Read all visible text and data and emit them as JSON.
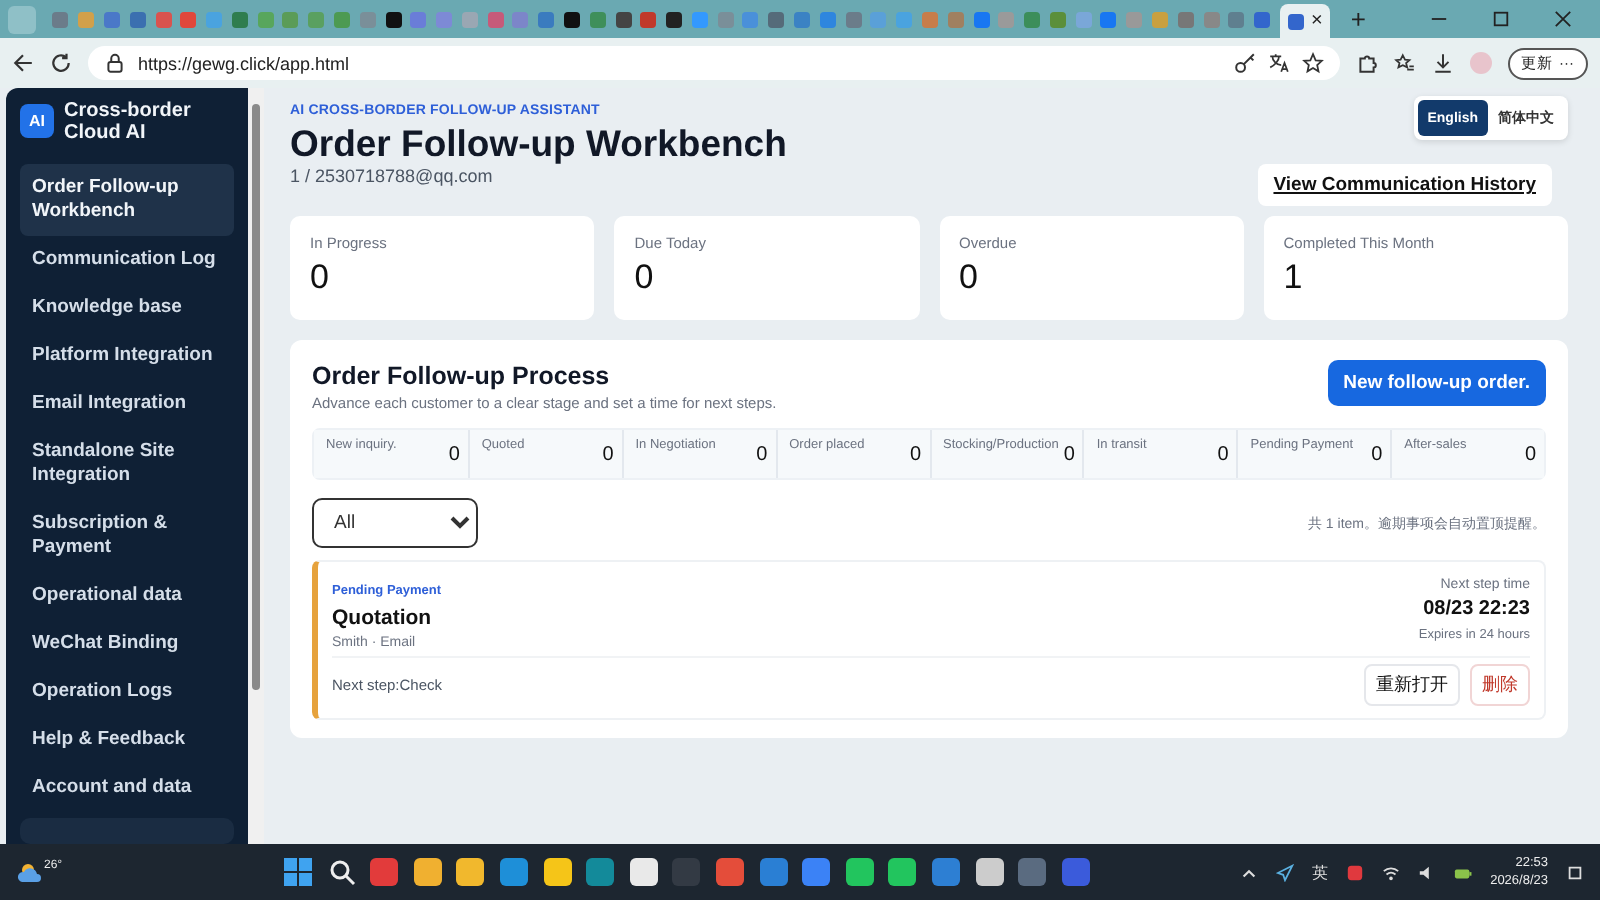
{
  "browser": {
    "tab_close": "×",
    "new_tab": "+",
    "url": "https://gewg.click/app.html",
    "update_button": "更新",
    "more": "···"
  },
  "sidebar": {
    "logo": "AI",
    "title": "Cross-border Cloud AI",
    "items": [
      {
        "label": "Order Follow-up Workbench",
        "selected": true
      },
      {
        "label": "Communication Log",
        "selected": false
      },
      {
        "label": "Knowledge base",
        "selected": false
      },
      {
        "label": "Platform Integration",
        "selected": false
      },
      {
        "label": "Email Integration",
        "selected": false
      },
      {
        "label": "Standalone Site Integration",
        "selected": false
      },
      {
        "label": "Subscription & Payment",
        "selected": false
      },
      {
        "label": "Operational data",
        "selected": false
      },
      {
        "label": "WeChat Binding",
        "selected": false
      },
      {
        "label": "Operation Logs",
        "selected": false
      },
      {
        "label": "Help & Feedback",
        "selected": false
      },
      {
        "label": "Account and data",
        "selected": false
      }
    ]
  },
  "header": {
    "eyebrow": "AI CROSS-BORDER FOLLOW-UP ASSISTANT",
    "title": "Order Follow-up Workbench",
    "subtitle": "1 / 2530718788@qq.com",
    "languages": [
      {
        "label": "English",
        "selected": true
      },
      {
        "label": "简体中文",
        "selected": false
      }
    ],
    "history_button": "View Communication History"
  },
  "stats": [
    {
      "label": "In Progress",
      "value": "0"
    },
    {
      "label": "Due Today",
      "value": "0"
    },
    {
      "label": "Overdue",
      "value": "0"
    },
    {
      "label": "Completed This Month",
      "value": "1"
    }
  ],
  "process": {
    "title": "Order Follow-up Process",
    "description": "Advance each customer to a clear stage and set a time for next steps.",
    "new_button": "New follow-up order.",
    "stages": [
      {
        "label": "New inquiry.",
        "count": "0"
      },
      {
        "label": "Quoted",
        "count": "0"
      },
      {
        "label": "In Negotiation",
        "count": "0"
      },
      {
        "label": "Order placed",
        "count": "0"
      },
      {
        "label": "Stocking/Production",
        "count": "0"
      },
      {
        "label": "In transit",
        "count": "0"
      },
      {
        "label": "Pending Payment",
        "count": "0"
      },
      {
        "label": "After-sales",
        "count": "0"
      }
    ],
    "filter": {
      "value": "All"
    },
    "summary": "共 1 item。逾期事项会自动置顶提醒。",
    "orders": [
      {
        "status": "Pending Payment",
        "title": "Quotation",
        "meta": "Smith · Email",
        "next_time_label": "Next step time",
        "next_time": "08/23 22:23",
        "expiry": "Expires in 24 hours",
        "next_step": "Next step:Check",
        "actions": [
          {
            "label": "重新打开",
            "kind": "default"
          },
          {
            "label": "删除",
            "kind": "danger"
          }
        ]
      }
    ]
  },
  "taskbar": {
    "weather": "26°",
    "input_method": "英",
    "time": "22:53",
    "date": "2026/8/23"
  }
}
